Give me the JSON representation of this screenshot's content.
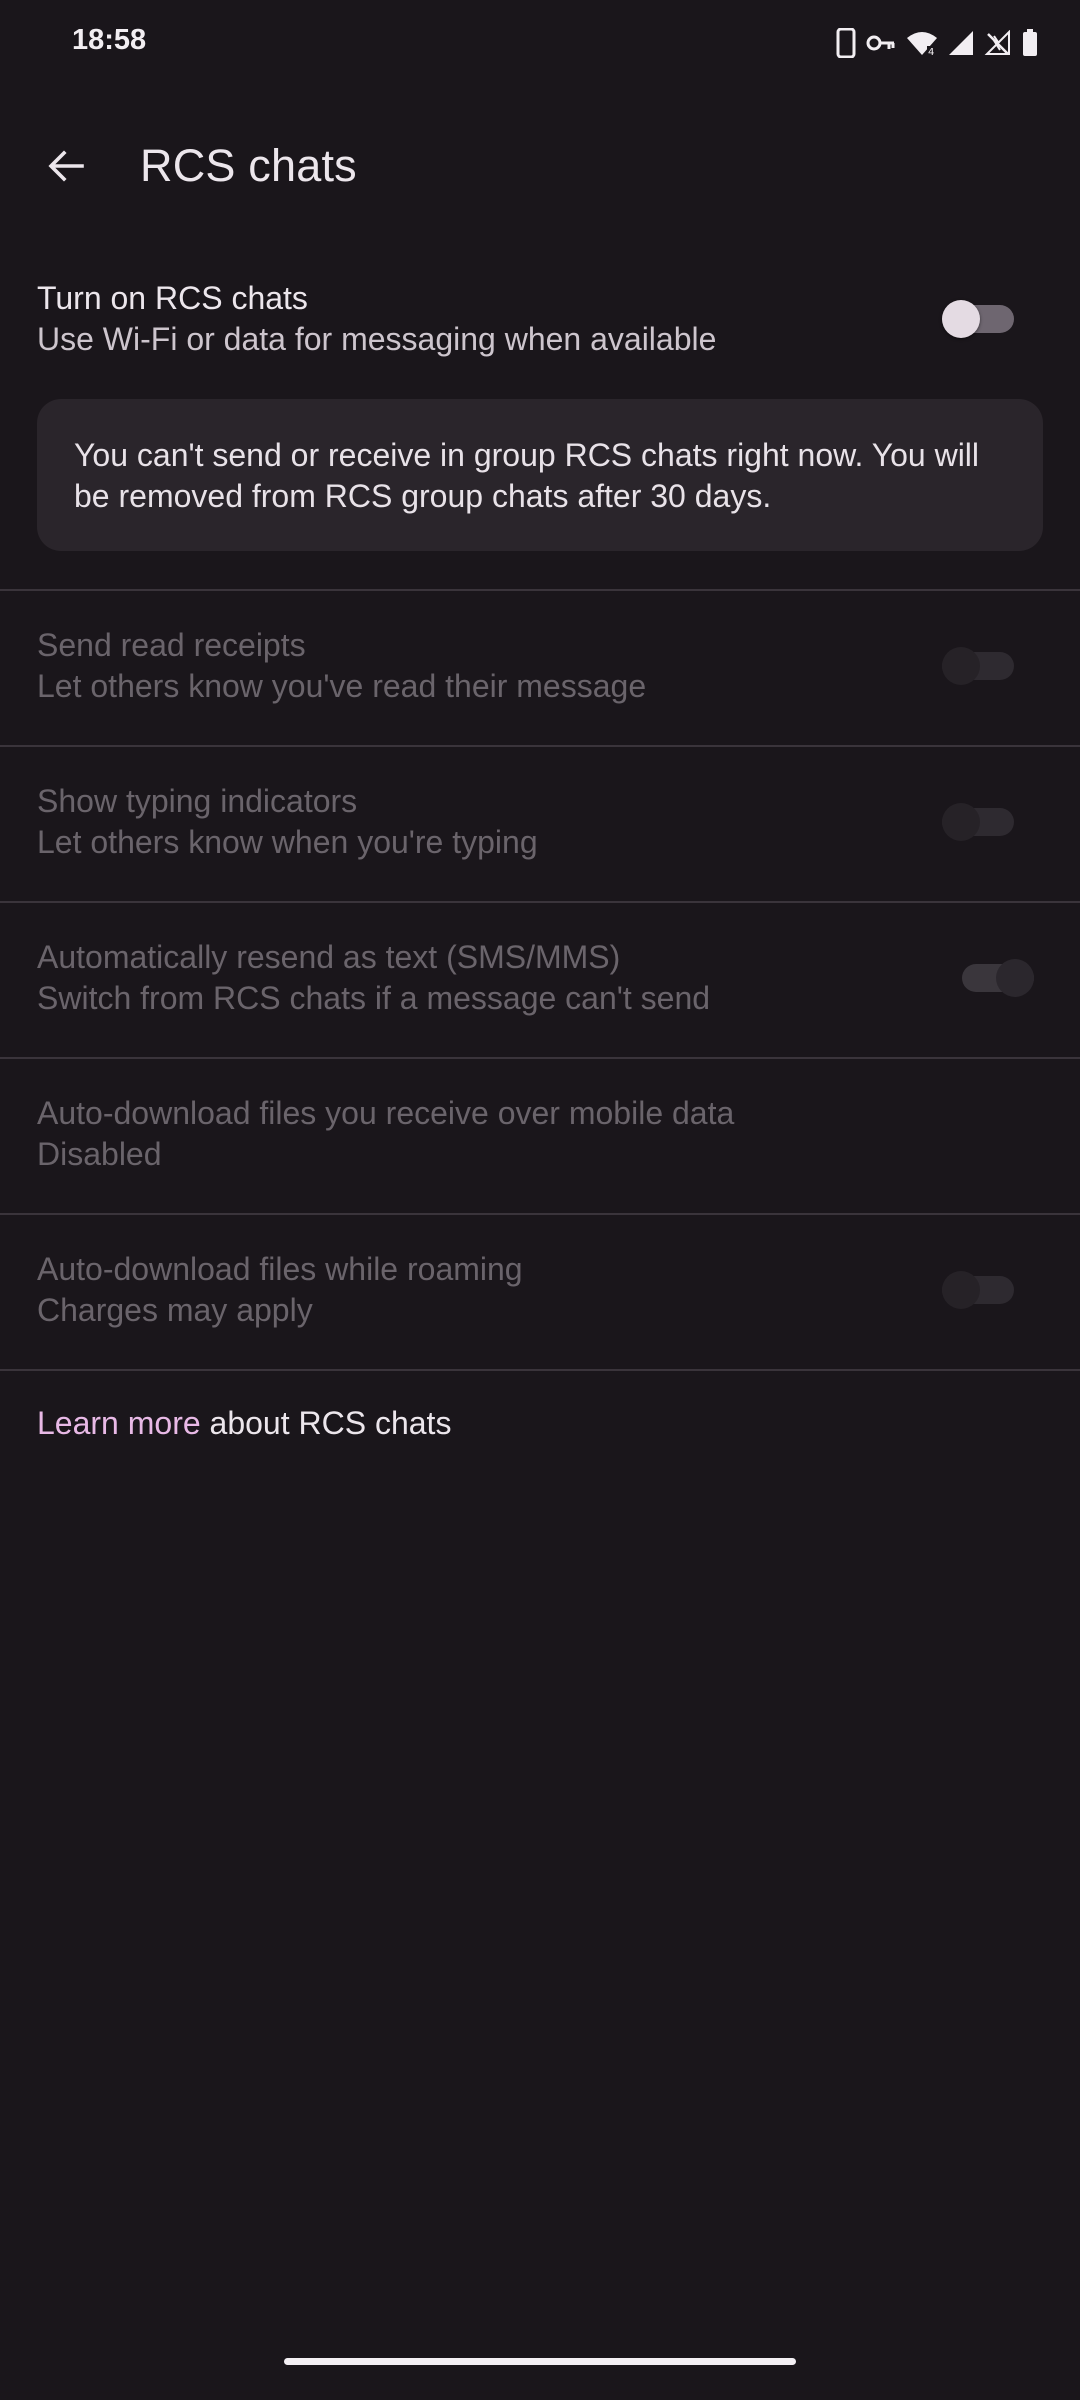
{
  "status_bar": {
    "time": "18:58",
    "icons": [
      "phone-icon",
      "vpn-key-icon",
      "wifi-icon",
      "signal-icon",
      "no-signal-icon",
      "battery-icon"
    ]
  },
  "app_bar": {
    "back_icon": "arrow-back-icon",
    "title": "RCS chats"
  },
  "main_setting": {
    "title": "Turn on RCS chats",
    "subtitle": "Use Wi-Fi or data for messaging when available",
    "toggle_on": false
  },
  "info_card": {
    "text": "You can't send or receive in group RCS chats right now. You will be removed from RCS group chats after 30 days."
  },
  "settings": [
    {
      "title": "Send read receipts",
      "subtitle": "Let others know you've read their message",
      "toggle_on": false,
      "enabled": false
    },
    {
      "title": "Show typing indicators",
      "subtitle": "Let others know when you're typing",
      "toggle_on": false,
      "enabled": false
    },
    {
      "title": "Automatically resend as text (SMS/MMS)",
      "subtitle": "Switch from RCS chats if a message can't send",
      "toggle_on": true,
      "enabled": false
    },
    {
      "title": "Auto-download files you receive over mobile data",
      "subtitle": "Disabled",
      "enabled": false
    },
    {
      "title": "Auto-download files while roaming",
      "subtitle": "Charges may apply",
      "toggle_on": false,
      "enabled": false
    }
  ],
  "footer": {
    "link_text": "Learn more",
    "suffix_text": " about RCS chats"
  },
  "colors": {
    "background": "#1a161b",
    "accent_link": "#e8b9e6",
    "card": "#2a252b"
  }
}
